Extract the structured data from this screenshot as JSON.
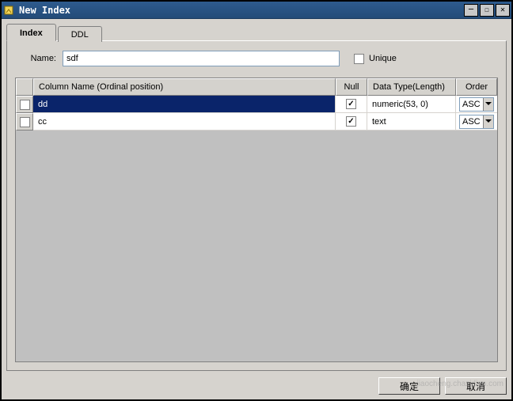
{
  "window": {
    "title": "New Index"
  },
  "tabs": {
    "index": "Index",
    "ddl": "DDL"
  },
  "form": {
    "name_label": "Name:",
    "name_value": "sdf",
    "unique_label": "Unique",
    "unique_checked": false
  },
  "table": {
    "headers": {
      "column_name": "Column Name (Ordinal position)",
      "null": "Null",
      "data_type": "Data Type(Length)",
      "order": "Order"
    },
    "rows": [
      {
        "checked": false,
        "name": "dd",
        "null": true,
        "data_type": "numeric(53, 0)",
        "order": "ASC",
        "selected": true
      },
      {
        "checked": false,
        "name": "cc",
        "null": true,
        "data_type": "text",
        "order": "ASC",
        "selected": false
      }
    ]
  },
  "footer": {
    "ok": "确定",
    "cancel": "取消"
  },
  "watermark": "jiaocheng.chazidian.com"
}
